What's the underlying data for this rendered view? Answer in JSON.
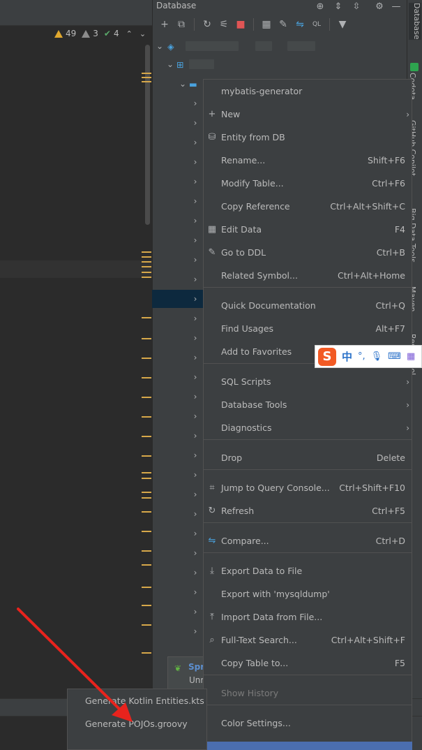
{
  "window": {
    "db_panel_title": "Database",
    "right_strip_tabs": [
      "Database",
      "Codota",
      "GitHub Copilot",
      "Big Data Tools",
      "Maven",
      "RestfulTool"
    ]
  },
  "editor": {
    "inspections": {
      "warnings": "49",
      "weak_warnings": "3",
      "typos": "4"
    }
  },
  "spring_popup": {
    "title": "Spr",
    "subtitle": "Unr"
  },
  "context_menu": {
    "items": [
      {
        "label": "mybatis-generator",
        "icon": "",
        "shortcut": "",
        "submenu": false
      },
      {
        "label": "New",
        "icon": "plus-icon",
        "shortcut": "",
        "submenu": true
      },
      {
        "label": "Entity from DB",
        "icon": "database-icon",
        "shortcut": "",
        "submenu": false
      },
      {
        "label": "Rename...",
        "icon": "",
        "shortcut": "Shift+F6",
        "submenu": false
      },
      {
        "label": "Modify Table...",
        "icon": "",
        "shortcut": "Ctrl+F6",
        "submenu": false
      },
      {
        "label": "Copy Reference",
        "icon": "",
        "shortcut": "Ctrl+Alt+Shift+C",
        "submenu": false
      },
      {
        "label": "Edit Data",
        "icon": "table-icon",
        "shortcut": "F4",
        "submenu": false
      },
      {
        "label": "Go to DDL",
        "icon": "pencil-icon",
        "shortcut": "Ctrl+B",
        "submenu": false
      },
      {
        "label": "Related Symbol...",
        "icon": "",
        "shortcut": "Ctrl+Alt+Home",
        "submenu": false
      },
      {
        "label": "Quick Documentation",
        "icon": "",
        "shortcut": "Ctrl+Q",
        "submenu": false
      },
      {
        "label": "Find Usages",
        "icon": "",
        "shortcut": "Alt+F7",
        "submenu": false
      },
      {
        "label": "Add to Favorites",
        "icon": "",
        "shortcut": "",
        "submenu": false
      },
      {
        "label": "SQL Scripts",
        "icon": "",
        "shortcut": "",
        "submenu": true
      },
      {
        "label": "Database Tools",
        "icon": "",
        "shortcut": "",
        "submenu": true
      },
      {
        "label": "Diagnostics",
        "icon": "",
        "shortcut": "",
        "submenu": true
      },
      {
        "label": "Drop",
        "icon": "",
        "shortcut": "Delete",
        "submenu": false
      },
      {
        "label": "Jump to Query Console...",
        "icon": "console-icon",
        "shortcut": "Ctrl+Shift+F10",
        "submenu": false
      },
      {
        "label": "Refresh",
        "icon": "refresh-icon",
        "shortcut": "Ctrl+F5",
        "submenu": false
      },
      {
        "label": "Compare...",
        "icon": "compare-icon",
        "shortcut": "Ctrl+D",
        "submenu": false
      },
      {
        "label": "Export Data to File",
        "icon": "export-icon",
        "shortcut": "",
        "submenu": false
      },
      {
        "label": "Export with 'mysqldump'",
        "icon": "",
        "shortcut": "",
        "submenu": false
      },
      {
        "label": "Import Data from File...",
        "icon": "import-icon",
        "shortcut": "",
        "submenu": false
      },
      {
        "label": "Full-Text Search...",
        "icon": "search-icon",
        "shortcut": "Ctrl+Alt+Shift+F",
        "submenu": false
      },
      {
        "label": "Copy Table to...",
        "icon": "",
        "shortcut": "F5",
        "submenu": false
      },
      {
        "label": "Show History",
        "icon": "",
        "shortcut": "",
        "submenu": false,
        "disabled": true
      },
      {
        "label": "Color Settings...",
        "icon": "",
        "shortcut": "",
        "submenu": false
      }
    ]
  },
  "submenu": {
    "items": [
      "Generate Kotlin Entities.kts",
      "Generate POJOs.groovy"
    ]
  },
  "ime_bar": {
    "mode": "中",
    "punct": "°,"
  },
  "colors": {
    "accent_selection": "#4b6eaf",
    "tree_selection": "#0d293e",
    "annotation_arrow": "#e8231d",
    "warning": "#e0a82e"
  }
}
